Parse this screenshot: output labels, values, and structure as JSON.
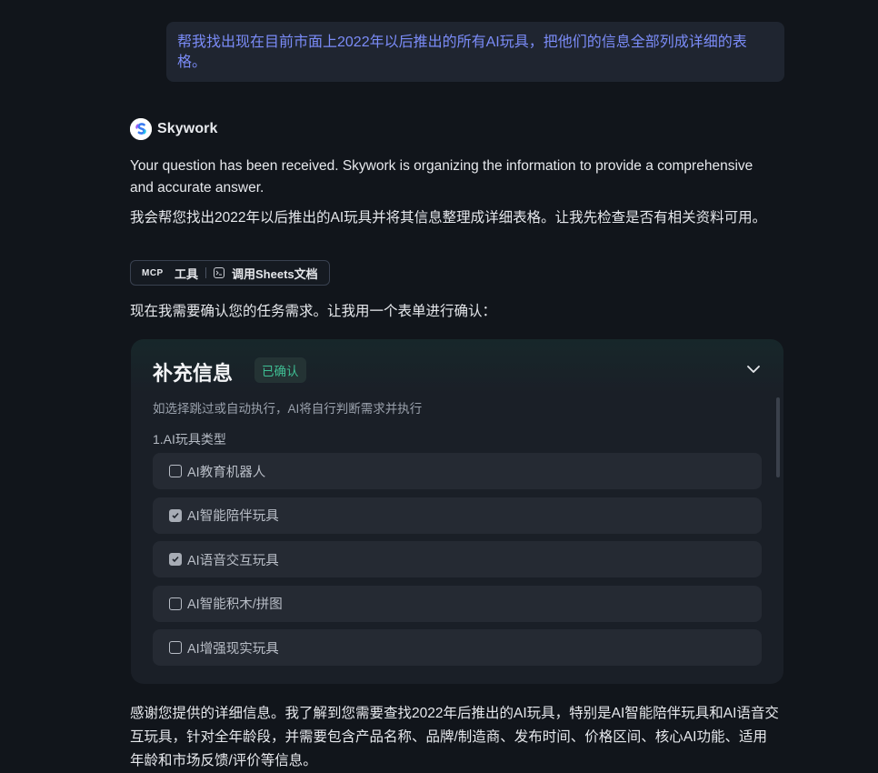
{
  "user_message": "帮我找出现在目前市面上2022年以后推出的所有AI玩具，把他们的信息全部列成详细的表格。",
  "assistant": {
    "name": "Skywork",
    "ack": "Your question has been received. Skywork is organizing the information to provide a comprehensive and accurate answer.",
    "intro": "我会帮您找出2022年以后推出的AI玩具并将其信息整理成详细表格。让我先检查是否有相关资料可用。",
    "tool_chip": {
      "label": "工具",
      "action": "调用Sheets文档",
      "icons": [
        "mcp-logo",
        "terminal-icon"
      ]
    },
    "confirm_prompt": "现在我需要确认您的任务需求。让我用一个表单进行确认：",
    "followup": "感谢您提供的详细信息。我了解到您需要查找2022年后推出的AI玩具，特别是AI智能陪伴玩具和AI语音交互玩具，针对全年龄段，并需要包含产品名称、品牌/制造商、发布时间、价格区间、核心AI功能、适用年龄和市场反馈/评价等信息。"
  },
  "form_card": {
    "title": "补充信息",
    "status": "已确认",
    "hint": "如选择跳过或自动执行，AI将自行判断需求并执行",
    "question": "1.AI玩具类型",
    "options": [
      {
        "label": "AI教育机器人",
        "checked": false
      },
      {
        "label": "AI智能陪伴玩具",
        "checked": true
      },
      {
        "label": "AI语音交互玩具",
        "checked": true
      },
      {
        "label": "AI智能积木/拼图",
        "checked": false
      },
      {
        "label": "AI增强现实玩具",
        "checked": false
      }
    ],
    "colors": {
      "status_text": "#3fbf94",
      "status_bg": "#243334",
      "card_bg": "#1a1f27",
      "option_bg": "#252a33"
    }
  },
  "colors": {
    "page_bg": "#11151b",
    "user_text": "#7b8cf8",
    "user_bubble_bg": "#1f2530"
  }
}
